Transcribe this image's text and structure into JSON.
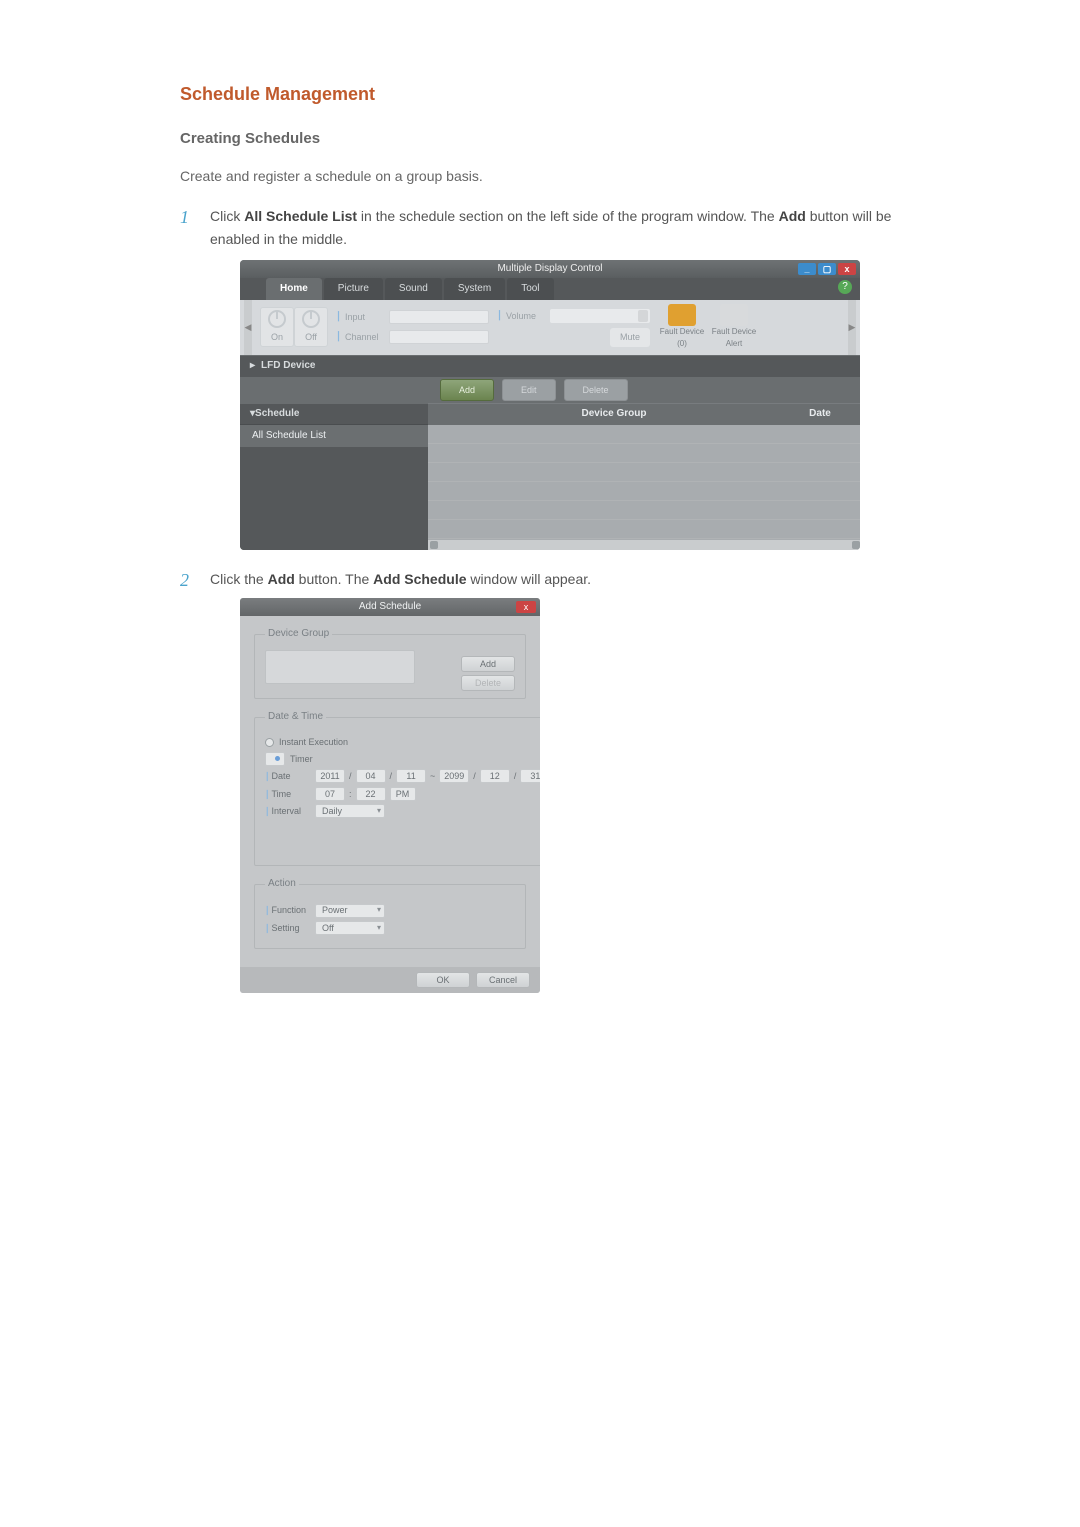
{
  "doc": {
    "title": "Schedule Management",
    "subtitle": "Creating Schedules",
    "intro": "Create and register a schedule on a group basis.",
    "steps": [
      {
        "n": "1",
        "pre": "Click ",
        "b1": "All Schedule List",
        "mid": " in the schedule section on the left side of the program window. The ",
        "b2": "Add",
        "post": " button will be enabled in the middle."
      },
      {
        "n": "2",
        "pre": "Click the ",
        "b1": "Add",
        "mid": " button. The ",
        "b2": "Add Schedule",
        "post": " window will appear."
      }
    ]
  },
  "win1": {
    "title": "Multiple Display Control",
    "min": "_",
    "max": "▢",
    "close": "x",
    "tabs": {
      "home": "Home",
      "picture": "Picture",
      "sound": "Sound",
      "system": "System",
      "tool": "Tool"
    },
    "help": "?",
    "power_on": "On",
    "power_off": "Off",
    "label_input": "Input",
    "label_channel": "Channel",
    "label_volume": "Volume",
    "mute": "Mute",
    "fault_dev": "Fault Device (0)",
    "fault_alert": "Fault Device Alert",
    "nav_left": "◀",
    "nav_right": "▶",
    "section_lfd": "LFD Device",
    "btn_add": "Add",
    "btn_edit": "Edit",
    "btn_delete": "Delete",
    "section_schedule": "Schedule",
    "col_devicegroup": "Device Group",
    "col_date": "Date",
    "item_allschedule": "All Schedule List",
    "caret_right": "▸",
    "caret_down": "▾"
  },
  "win2": {
    "title": "Add Schedule",
    "close": "x",
    "fs_devicegroup": "Device Group",
    "btn_add": "Add",
    "btn_delete": "Delete",
    "fs_datetime": "Date & Time",
    "radio_instant": "Instant Execution",
    "radio_timer": "Timer",
    "label_date": "Date",
    "date_y1": "2011",
    "date_m1": "04",
    "date_d1": "11",
    "date_sep": " / ",
    "date_tilde": " ~ ",
    "date_y2": "2099",
    "date_m2": "12",
    "date_d2": "31",
    "label_time": "Time",
    "time_h": "07",
    "time_m": "22",
    "time_ap": "PM",
    "label_interval": "Interval",
    "interval_val": "Daily",
    "fs_action": "Action",
    "label_function": "Function",
    "function_val": "Power",
    "label_setting": "Setting",
    "setting_val": "Off",
    "btn_ok": "OK",
    "btn_cancel": "Cancel"
  }
}
